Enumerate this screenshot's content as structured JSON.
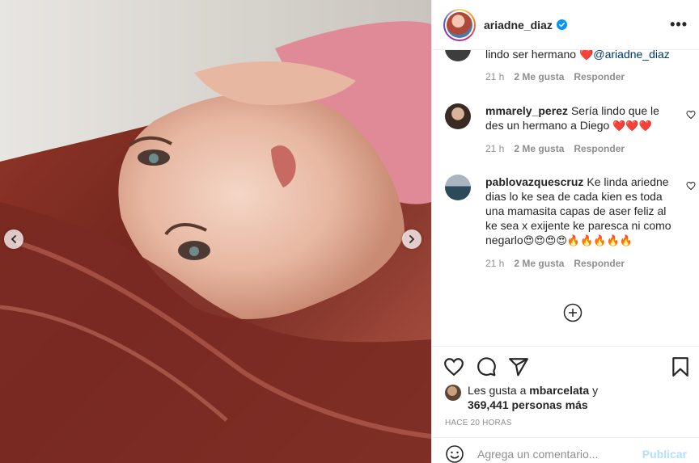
{
  "post": {
    "username": "ariadne_diaz",
    "verified_icon": "verified-badge-icon",
    "more_icon": "more-options-icon",
    "more_label": "•••"
  },
  "media": {
    "prev_icon": "chevron-left-icon",
    "next_icon": "chevron-right-icon"
  },
  "comments": [
    {
      "username": "",
      "text": "lindo ser hermano ",
      "suffix": "@ariadne_diaz",
      "time": "21 h",
      "likes": "2 Me gusta",
      "reply": "Responder"
    },
    {
      "username": "mmarely_perez",
      "text": "Sería lindo que le des un hermano a Diego ",
      "suffix": "❤️❤️❤️",
      "time": "21 h",
      "likes": "2 Me gusta",
      "reply": "Responder"
    },
    {
      "username": "pablovazquescruz",
      "text": "Ke linda ariedne dias lo ke sea de cada kien es toda una mamasita capas de aser feliz al ke sea x exijente ke paresca ni como negarlo",
      "suffix": "😍😍😍😍🔥🔥🔥🔥🔥",
      "time": "21 h",
      "likes": "2 Me gusta",
      "reply": "Responder"
    }
  ],
  "load_more_icon": "plus-circle-icon",
  "actions": {
    "like_icon": "heart-icon",
    "comment_icon": "comment-icon",
    "share_icon": "share-icon",
    "save_icon": "bookmark-icon"
  },
  "likes": {
    "prefix": "Les gusta a ",
    "user": "mbarcelata",
    "middle": " y",
    "count": "369,441 personas más"
  },
  "timestamp": "Hace 20 horas",
  "add_comment": {
    "placeholder": "Agrega un comentario...",
    "publish": "Publicar"
  },
  "colors": {
    "accent_link": "#0095f6",
    "publish_disabled": "#b2dffc",
    "meta_gray": "#8e8e8e",
    "heart_red": "#e0245e"
  }
}
